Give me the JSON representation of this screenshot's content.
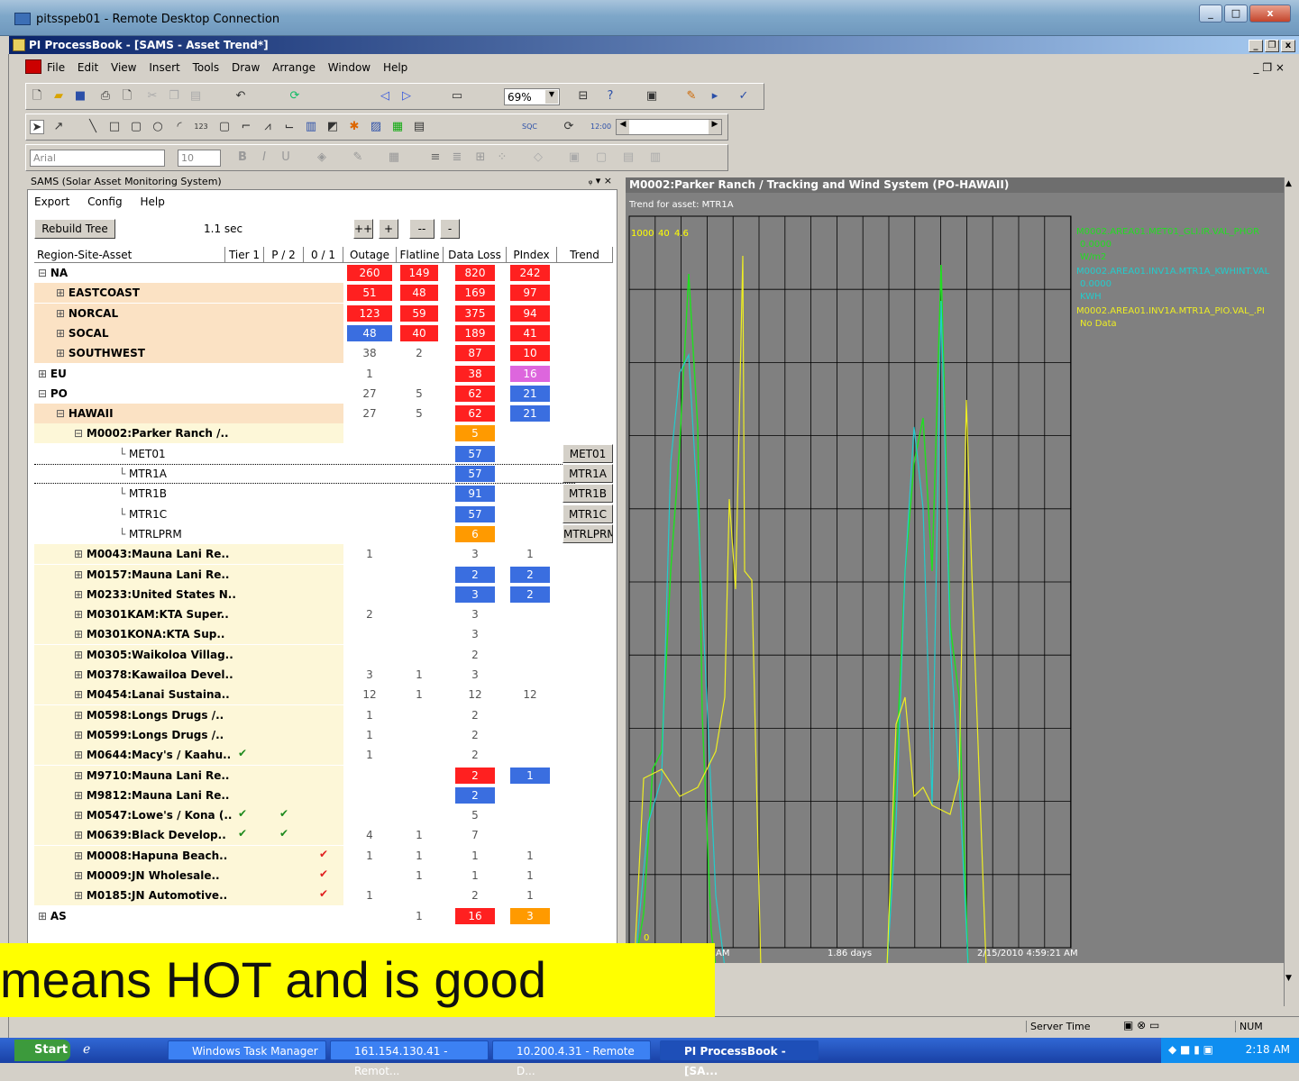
{
  "remote_title": "pitsspeb01 - Remote Desktop Connection",
  "window_title": "PI ProcessBook - [SAMS - Asset Trend*]",
  "menu": [
    "File",
    "Edit",
    "View",
    "Insert",
    "Tools",
    "Draw",
    "Arrange",
    "Window",
    "Help"
  ],
  "font_name": "Arial",
  "font_size": "10",
  "zoom": "69%",
  "pane_title": "SAMS (Solar Asset Monitoring System)",
  "pane_menu": [
    "Export",
    "Config",
    "Help"
  ],
  "rebuild_label": "Rebuild Tree",
  "elapsed": "1.1 sec",
  "expand_all": "++",
  "expand": "+",
  "collapse_all": "--",
  "collapse": "-",
  "headers": [
    "Region-Site-Asset",
    "Tier 1",
    "P / 2",
    "0 / 1",
    "Outage",
    "Flatline",
    "Data Loss",
    "PIndex",
    "Trend"
  ],
  "rows": [
    {
      "name": "NA",
      "outage": "260",
      "flatline": "149",
      "dataloss": "820",
      "pindex": "242"
    },
    {
      "name": "EASTCOAST",
      "outage": "51",
      "flatline": "48",
      "dataloss": "169",
      "pindex": "97"
    },
    {
      "name": "NORCAL",
      "outage": "123",
      "flatline": "59",
      "dataloss": "375",
      "pindex": "94"
    },
    {
      "name": "SOCAL",
      "outage": "48",
      "flatline": "40",
      "dataloss": "189",
      "pindex": "41"
    },
    {
      "name": "SOUTHWEST",
      "outage": "38",
      "flatline": "2",
      "dataloss": "87",
      "pindex": "10"
    },
    {
      "name": "EU",
      "outage": "1",
      "flatline": "",
      "dataloss": "38",
      "pindex": "16"
    },
    {
      "name": "PO",
      "outage": "27",
      "flatline": "5",
      "dataloss": "62",
      "pindex": "21"
    },
    {
      "name": "HAWAII",
      "outage": "27",
      "flatline": "5",
      "dataloss": "62",
      "pindex": "21"
    },
    {
      "name": "M0002:Parker Ranch /..",
      "outage": "",
      "flatline": "",
      "dataloss": "5",
      "pindex": ""
    },
    {
      "name": "MET01",
      "outage": "",
      "flatline": "",
      "dataloss": "57",
      "pindex": "",
      "trend": "MET01"
    },
    {
      "name": "MTR1A",
      "outage": "",
      "flatline": "",
      "dataloss": "57",
      "pindex": "",
      "trend": "MTR1A"
    },
    {
      "name": "MTR1B",
      "outage": "",
      "flatline": "",
      "dataloss": "91",
      "pindex": "",
      "trend": "MTR1B"
    },
    {
      "name": "MTR1C",
      "outage": "",
      "flatline": "",
      "dataloss": "57",
      "pindex": "",
      "trend": "MTR1C"
    },
    {
      "name": "MTRLPRM",
      "outage": "",
      "flatline": "",
      "dataloss": "6",
      "pindex": "",
      "trend": "MTRLPRM"
    },
    {
      "name": "M0043:Mauna Lani Re..",
      "outage": "1",
      "flatline": "",
      "dataloss": "3",
      "pindex": "1"
    },
    {
      "name": "M0157:Mauna Lani Re..",
      "outage": "",
      "flatline": "",
      "dataloss": "2",
      "pindex": "2"
    },
    {
      "name": "M0233:United States N..",
      "outage": "",
      "flatline": "",
      "dataloss": "3",
      "pindex": "2"
    },
    {
      "name": "M0301KAM:KTA Super..",
      "outage": "2",
      "flatline": "",
      "dataloss": "3",
      "pindex": ""
    },
    {
      "name": "M0301KONA:KTA Sup..",
      "outage": "",
      "flatline": "",
      "dataloss": "3",
      "pindex": ""
    },
    {
      "name": "M0305:Waikoloa Villag..",
      "outage": "",
      "flatline": "",
      "dataloss": "2",
      "pindex": ""
    },
    {
      "name": "M0378:Kawailoa Devel..",
      "outage": "3",
      "flatline": "1",
      "dataloss": "3",
      "pindex": ""
    },
    {
      "name": "M0454:Lanai Sustaina..",
      "outage": "12",
      "flatline": "1",
      "dataloss": "12",
      "pindex": "12"
    },
    {
      "name": "M0598:Longs Drugs /..",
      "outage": "1",
      "flatline": "",
      "dataloss": "2",
      "pindex": ""
    },
    {
      "name": "M0599:Longs Drugs /..",
      "outage": "1",
      "flatline": "",
      "dataloss": "2",
      "pindex": ""
    },
    {
      "name": "M0644:Macy's / Kaahu..",
      "outage": "1",
      "flatline": "",
      "dataloss": "2",
      "pindex": ""
    },
    {
      "name": "M9710:Mauna Lani Re..",
      "outage": "",
      "flatline": "",
      "dataloss": "2",
      "pindex": "1"
    },
    {
      "name": "M9812:Mauna Lani Re..",
      "outage": "",
      "flatline": "",
      "dataloss": "2",
      "pindex": ""
    },
    {
      "name": "M0547:Lowe's / Kona (..",
      "outage": "",
      "flatline": "",
      "dataloss": "5",
      "pindex": ""
    },
    {
      "name": "M0639:Black Develop..",
      "outage": "4",
      "flatline": "1",
      "dataloss": "7",
      "pindex": ""
    },
    {
      "name": "M0008:Hapuna Beach..",
      "outage": "1",
      "flatline": "1",
      "dataloss": "1",
      "pindex": "1"
    },
    {
      "name": "M0009:JN Wholesale..",
      "outage": "",
      "flatline": "1",
      "dataloss": "1",
      "pindex": "1"
    },
    {
      "name": "M0185:JN Automotive..",
      "outage": "1",
      "flatline": "",
      "dataloss": "2",
      "pindex": "1"
    },
    {
      "name": "AS",
      "outage": "",
      "flatline": "1",
      "dataloss": "16",
      "pindex": "3"
    }
  ],
  "colors": {
    "red": "#ff2020",
    "blue": "#3a6ee0",
    "orange": "#ff9a00",
    "magenta": "#dd66dd",
    "tier_bg": "#fbe2c4",
    "site_bg": "#fdf7d8"
  },
  "trend_title": "M0002:Parker Ranch / Tracking and Wind System (PO-HAWAII)",
  "trend_subtitle": "Trend for asset: MTR1A",
  "legend": [
    {
      "tag": "M0002.AREA01.MET01_GLI.IR.VAL_PHOR",
      "value": "0.0000",
      "unit": "W/m2",
      "color": "#22dd22"
    },
    {
      "tag": "M0002.AREA01.INV1A.MTR1A_KWHINT.VAL",
      "value": "0.0000",
      "unit": "KWH",
      "color": "#22cccc"
    },
    {
      "tag": "M0002.AREA01.INV1A.MTR1A_PIO.VAL_.PI",
      "value": "No Data",
      "unit": "",
      "color": "#eeee22"
    }
  ],
  "trend_top_labels": [
    "1000",
    "40",
    "4.6"
  ],
  "trend_bottom": {
    "left": "AM",
    "span": "1.86 days",
    "end": "2/15/2010 4:59:21 AM",
    "zero": "0"
  },
  "status_server": "Server Time",
  "status_num": "NUM",
  "taskbar": {
    "start": "Start",
    "items": [
      "Windows Task Manager",
      "161.154.130.41 - Remot...",
      "10.200.4.31 - Remote D...",
      "PI ProcessBook - [SA..."
    ],
    "clock": "2:18 AM"
  },
  "overlay_text": "means HOT and is good"
}
